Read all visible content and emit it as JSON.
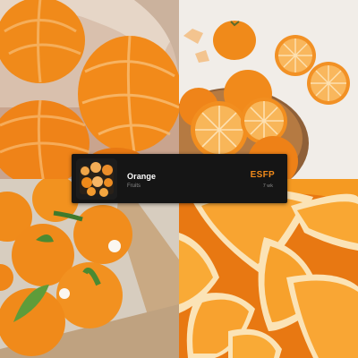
{
  "card": {
    "title": "Orange",
    "subtitle": "Fruits",
    "tag": "ESFP",
    "meta": "7 wk",
    "accent": "#f08a1a"
  },
  "images": [
    {
      "content": "peeled-mandarins-in-bowl"
    },
    {
      "content": "tangerines-and-sliced-oranges-in-basket"
    },
    {
      "content": "dekopon-oranges-with-leaves-in-box"
    },
    {
      "content": "orange-wedges-closeup"
    }
  ],
  "colors": {
    "orange": "#f08a1a",
    "light_orange": "#f9b15a",
    "peel": "#ea7a14",
    "leaf": "#3f7a2c",
    "background": "#1b1b1b"
  }
}
